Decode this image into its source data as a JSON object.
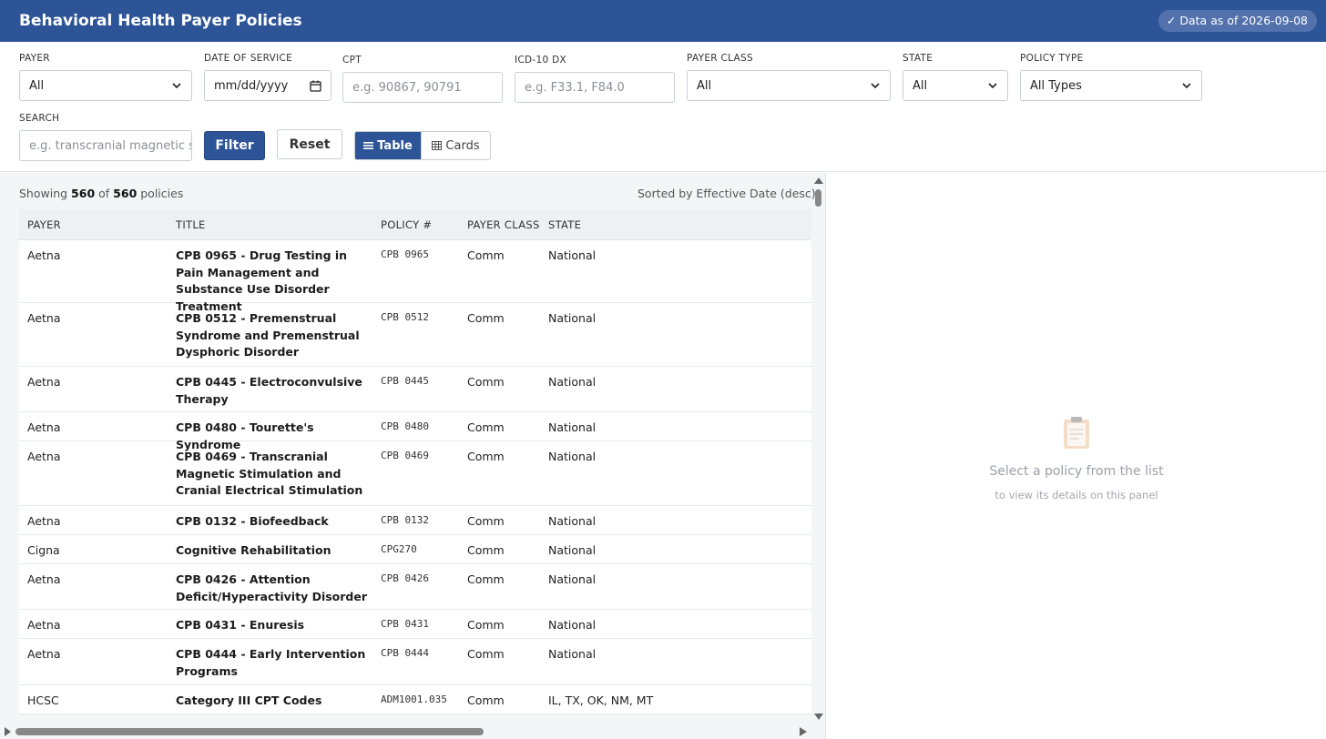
{
  "header": {
    "title": "Behavioral Health Payer Policies",
    "data_as_of": "✓ Data as of 2026-09-08"
  },
  "filters": {
    "payer": {
      "label": "PAYER",
      "value": "All"
    },
    "date_of_service": {
      "label": "DATE OF SERVICE",
      "placeholder": "mm/dd/yyyy"
    },
    "cpt": {
      "label": "CPT",
      "placeholder": "e.g. 90867, 90791"
    },
    "icd10": {
      "label": "ICD-10 DX",
      "placeholder": "e.g. F33.1, F84.0"
    },
    "payer_class": {
      "label": "PAYER CLASS",
      "value": "All"
    },
    "state": {
      "label": "STATE",
      "value": "All"
    },
    "policy_type": {
      "label": "POLICY TYPE",
      "value": "All Types"
    },
    "search": {
      "label": "SEARCH",
      "placeholder": "e.g. transcranial magnetic st"
    },
    "filter_button": "Filter",
    "reset_button": "Reset",
    "view_table": "Table",
    "view_cards": "Cards"
  },
  "summary": {
    "prefix": "Showing",
    "shown": "560",
    "of": "of",
    "total": "560",
    "suffix": "policies",
    "sorted_by": "Sorted by Effective Date (desc)"
  },
  "table": {
    "columns": [
      "PAYER",
      "TITLE",
      "POLICY #",
      "PAYER CLASS",
      "STATE"
    ],
    "rows": [
      {
        "payer": "Aetna",
        "title": "CPB 0965 - Drug Testing in Pain Management and Substance Use Disorder Treatment",
        "policy": "CPB 0965",
        "payer_class": "Comm",
        "state": "National"
      },
      {
        "payer": "Aetna",
        "title": "CPB 0512 - Premenstrual Syndrome and Premenstrual Dysphoric Disorder",
        "policy": "CPB 0512",
        "payer_class": "Comm",
        "state": "National"
      },
      {
        "payer": "Aetna",
        "title": "CPB 0445 - Electroconvulsive Therapy",
        "policy": "CPB 0445",
        "payer_class": "Comm",
        "state": "National"
      },
      {
        "payer": "Aetna",
        "title": "CPB 0480 - Tourette's Syndrome",
        "policy": "CPB 0480",
        "payer_class": "Comm",
        "state": "National"
      },
      {
        "payer": "Aetna",
        "title": "CPB 0469 - Transcranial Magnetic Stimulation and Cranial Electrical Stimulation",
        "policy": "CPB 0469",
        "payer_class": "Comm",
        "state": "National"
      },
      {
        "payer": "Aetna",
        "title": "CPB 0132 - Biofeedback",
        "policy": "CPB 0132",
        "payer_class": "Comm",
        "state": "National"
      },
      {
        "payer": "Cigna",
        "title": "Cognitive Rehabilitation",
        "policy": "CPG270",
        "payer_class": "Comm",
        "state": "National"
      },
      {
        "payer": "Aetna",
        "title": "CPB 0426 - Attention Deficit/Hyperactivity Disorder",
        "policy": "CPB 0426",
        "payer_class": "Comm",
        "state": "National"
      },
      {
        "payer": "Aetna",
        "title": "CPB 0431 - Enuresis",
        "policy": "CPB 0431",
        "payer_class": "Comm",
        "state": "National"
      },
      {
        "payer": "Aetna",
        "title": "CPB 0444 - Early Intervention Programs",
        "policy": "CPB 0444",
        "payer_class": "Comm",
        "state": "National"
      },
      {
        "payer": "HCSC",
        "title": "Category III CPT Codes",
        "policy": "ADM1001.035",
        "payer_class": "Comm",
        "state": "IL, TX, OK, NM, MT"
      }
    ]
  },
  "detail": {
    "empty_title": "Select a policy from the list",
    "empty_sub": "to view its details on this panel"
  }
}
